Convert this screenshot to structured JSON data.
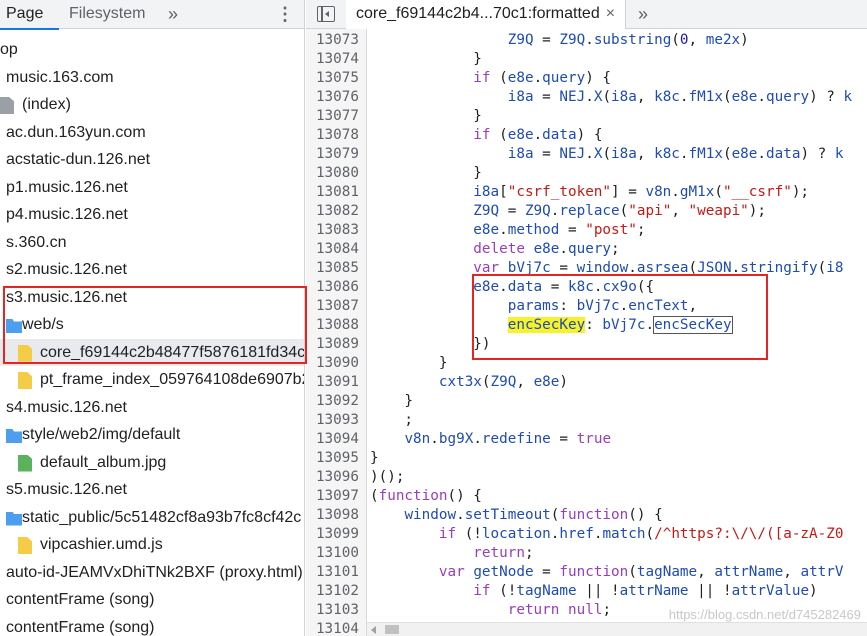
{
  "left_panel": {
    "tabs": {
      "page": "Page",
      "filesystem": "Filesystem",
      "more": "»",
      "kebab": "⋮"
    },
    "tree": [
      {
        "label": "op",
        "icon": "none",
        "indent": 0
      },
      {
        "label": "music.163.com",
        "icon": "none",
        "indent": 6
      },
      {
        "label": "(index)",
        "icon": "file",
        "indent": 22
      },
      {
        "label": "ac.dun.163yun.com",
        "icon": "none",
        "indent": 6
      },
      {
        "label": "acstatic-dun.126.net",
        "icon": "none",
        "indent": 6
      },
      {
        "label": "p1.music.126.net",
        "icon": "none",
        "indent": 6
      },
      {
        "label": "p4.music.126.net",
        "icon": "none",
        "indent": 6
      },
      {
        "label": "s.360.cn",
        "icon": "none",
        "indent": 6
      },
      {
        "label": "s2.music.126.net",
        "icon": "none",
        "indent": 6
      },
      {
        "label": "s3.music.126.net",
        "icon": "none",
        "indent": 6
      },
      {
        "label": "web/s",
        "icon": "folder",
        "indent": 22
      },
      {
        "label": "core_f69144c2b48477f5876181fd34c",
        "icon": "js",
        "indent": 40,
        "selected": true
      },
      {
        "label": "pt_frame_index_059764108de6907b2",
        "icon": "js",
        "indent": 40
      },
      {
        "label": "s4.music.126.net",
        "icon": "none",
        "indent": 6
      },
      {
        "label": "style/web2/img/default",
        "icon": "folder",
        "indent": 22
      },
      {
        "label": "default_album.jpg",
        "icon": "img",
        "indent": 40
      },
      {
        "label": "s5.music.126.net",
        "icon": "none",
        "indent": 6
      },
      {
        "label": "static_public/5c51482cf8a93b7fc8cf42c",
        "icon": "folder",
        "indent": 22
      },
      {
        "label": "vipcashier.umd.js",
        "icon": "js",
        "indent": 40
      },
      {
        "label": "auto-id-JEAMVxDhiTNk2BXF (proxy.html)",
        "icon": "none",
        "indent": 6
      },
      {
        "label": "contentFrame (song)",
        "icon": "none",
        "indent": 6
      },
      {
        "label": "contentFrame (song)",
        "icon": "none",
        "indent": 6
      }
    ]
  },
  "editor": {
    "tab_title": "core_f69144c2b4...70c1:formatted",
    "tab_close": "×",
    "more": "»",
    "lines": [
      {
        "n": "13073",
        "code": "                Z9Q = Z9Q.substring(0, me2x)"
      },
      {
        "n": "13074",
        "code": "            }"
      },
      {
        "n": "13075",
        "code": "            if (e8e.query) {"
      },
      {
        "n": "13076",
        "code": "                i8a = NEJ.X(i8a, k8c.fM1x(e8e.query) ? k"
      },
      {
        "n": "13077",
        "code": "            }"
      },
      {
        "n": "13078",
        "code": "            if (e8e.data) {"
      },
      {
        "n": "13079",
        "code": "                i8a = NEJ.X(i8a, k8c.fM1x(e8e.data) ? k"
      },
      {
        "n": "13080",
        "code": "            }"
      },
      {
        "n": "13081",
        "code": "            i8a[\"csrf_token\"] = v8n.gM1x(\"__csrf\");"
      },
      {
        "n": "13082",
        "code": "            Z9Q = Z9Q.replace(\"api\", \"weapi\");"
      },
      {
        "n": "13083",
        "code": "            e8e.method = \"post\";"
      },
      {
        "n": "13084",
        "code": "            delete e8e.query;"
      },
      {
        "n": "13085",
        "code": "            var bVj7c = window.asrsea(JSON.stringify(i8"
      },
      {
        "n": "13086",
        "code": "            e8e.data = k8c.cx9o({"
      },
      {
        "n": "13087",
        "code": "                params: bVj7c.encText,"
      },
      {
        "n": "13088",
        "code": "                encSecKey: bVj7c.encSecKey"
      },
      {
        "n": "13089",
        "code": "            })"
      },
      {
        "n": "13090",
        "code": "        }"
      },
      {
        "n": "13091",
        "code": "        cxt3x(Z9Q, e8e)"
      },
      {
        "n": "13092",
        "code": "    }"
      },
      {
        "n": "13093",
        "code": "    ;"
      },
      {
        "n": "13094",
        "code": "    v8n.bg9X.redefine = true"
      },
      {
        "n": "13095",
        "code": "}"
      },
      {
        "n": "13096",
        "code": ")();"
      },
      {
        "n": "13097",
        "code": "(function() {"
      },
      {
        "n": "13098",
        "code": "    window.setTimeout(function() {"
      },
      {
        "n": "13099",
        "code": "        if (!location.href.match(/^https?:\\/\\/([a-zA-Z0"
      },
      {
        "n": "13100",
        "code": "            return;"
      },
      {
        "n": "13101",
        "code": "        var getNode = function(tagName, attrName, attrV"
      },
      {
        "n": "13102",
        "code": "            if (!tagName || !attrName || !attrValue)"
      },
      {
        "n": "13103",
        "code": "                return null;"
      },
      {
        "n": "13104",
        "code": ""
      }
    ]
  },
  "watermark": "https://blog.csdn.net/d745282469"
}
